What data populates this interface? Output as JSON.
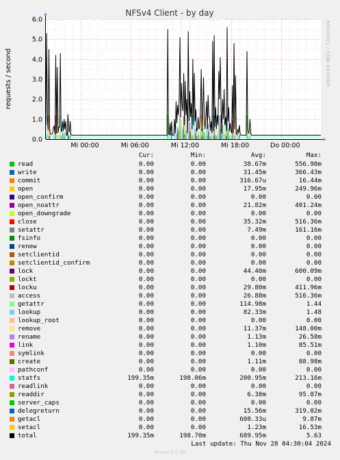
{
  "chart_data": {
    "type": "line",
    "title": "NFSv4 Client - by day",
    "ylabel": "requests / second",
    "ylim": [
      0,
      6
    ],
    "yticks": [
      "0.0",
      "1.0",
      "2.0",
      "3.0",
      "4.0",
      "5.0",
      "6.0"
    ],
    "xticks": [
      "Mi 00:00",
      "Mi 06:00",
      "Mi 12:00",
      "Mi 18:00",
      "Do 00:00"
    ],
    "grid": true,
    "series_total": {
      "name": "total",
      "color": "#000000",
      "values": [
        0.7,
        5.3,
        1.1,
        0.45,
        4.5,
        0.5,
        0.25,
        0.25,
        0.25,
        0.3,
        0.6,
        0.65,
        0.25,
        4.2,
        0.3,
        3.6,
        0.3,
        0.6,
        0.6,
        4.3,
        0.5,
        0.35,
        0.9,
        0.4,
        1.0,
        0.5,
        0.9,
        0.2,
        0.2,
        1.25,
        0.5,
        0.35,
        0.9,
        0.25,
        0.2,
        0.2,
        0.2,
        0.2,
        0.2,
        0.2,
        0.2,
        0.2,
        0.2,
        0.2,
        0.2,
        0.2,
        0.2,
        0.2,
        0.2,
        0.2,
        0.2,
        0.2,
        0.2,
        0.2,
        0.2,
        0.2,
        0.2,
        0.2,
        0.2,
        0.2,
        0.2,
        0.2,
        0.2,
        0.2,
        0.2,
        0.2,
        0.2,
        0.2,
        0.2,
        0.2,
        0.2,
        0.2,
        0.2,
        0.2,
        0.2,
        0.2,
        0.2,
        0.2,
        0.2,
        0.2,
        0.2,
        0.2,
        0.2,
        0.2,
        0.2,
        0.2,
        0.2,
        0.2,
        0.2,
        0.2,
        0.2,
        0.2,
        0.2,
        0.2,
        0.2,
        0.2,
        0.2,
        0.2,
        0.2,
        0.2,
        0.2,
        0.2,
        0.2,
        0.2,
        0.2,
        0.2,
        0.2,
        0.2,
        0.2,
        0.2,
        0.2,
        0.2,
        0.2,
        0.2,
        0.2,
        0.2,
        0.2,
        0.2,
        0.2,
        0.2,
        0.2,
        0.2,
        0.2,
        0.2,
        0.2,
        0.2,
        0.2,
        0.2,
        0.2,
        0.2,
        0.2,
        0.2,
        0.2,
        0.2,
        0.2,
        0.2,
        0.2,
        0.2,
        0.2,
        0.2,
        0.2,
        0.2,
        0.2,
        0.2,
        0.2,
        0.2,
        0.2,
        0.2,
        0.2,
        0.2,
        0.2,
        0.2,
        0.2,
        0.2,
        0.2,
        0.2,
        0.2,
        0.2,
        0.2,
        0.2,
        5.5,
        0.3,
        0.2,
        0.8,
        0.2,
        0.9,
        0.2,
        0.2,
        0.2,
        1.0,
        0.3,
        1.9,
        0.8,
        1.7,
        1.2,
        2.0,
        5.1,
        1.1,
        2.8,
        1.7,
        1.4,
        3.3,
        0.7,
        2.9,
        1.2,
        2.0,
        0.3,
        5.4,
        0.9,
        2.4,
        1.1,
        1.8,
        0.5,
        4.0,
        0.7,
        3.3,
        0.9,
        1.5,
        0.4,
        0.5,
        1.1,
        0.5,
        0.6,
        1.6,
        3.5,
        0.4,
        1.5,
        3.1,
        1.0,
        0.5,
        1.2,
        1.9,
        0.5,
        2.2,
        1.1,
        1.1,
        0.4,
        0.9,
        0.3,
        4.9,
        0.4,
        5.2,
        0.6,
        1.6,
        0.5,
        1.2,
        0.7,
        3.4,
        2.0,
        4.1,
        1.5,
        0.3,
        2.0,
        1.0,
        2.5,
        0.7,
        1.1,
        0.4,
        5.6,
        0.9,
        1.6,
        0.4,
        0.8,
        0.4,
        0.3,
        2.7,
        0.3,
        4.8,
        0.5,
        3.2,
        0.3,
        0.2,
        0.5,
        0.3,
        0.7,
        0.3,
        0.2,
        0.2,
        0.2,
        0.2,
        0.2,
        0.2,
        0.2,
        0.2,
        4.4,
        0.5,
        0.3,
        0.4,
        1.0,
        0.3,
        0.2,
        0.2,
        0.2,
        0.2,
        0.2,
        0.2,
        0.2,
        0.2,
        0.2,
        0.2,
        0.2,
        0.2,
        0.2,
        0.2,
        0.2,
        0.2,
        0.2,
        0.2,
        0.2,
        0.2,
        0.2,
        0.2,
        0.2,
        0.2,
        0.2,
        0.2,
        0.2,
        0.2,
        0.2,
        0.2,
        0.2,
        0.2,
        0.2,
        0.2,
        0.2,
        0.2,
        0.2,
        0.2,
        0.2,
        0.2,
        0.2,
        0.2,
        0.2,
        0.2,
        0.2,
        0.2,
        0.2,
        0.2,
        0.2,
        0.2,
        0.2,
        0.2,
        0.2,
        0.2,
        0.2,
        0.2,
        0.2,
        0.2,
        0.2,
        0.2,
        0.2,
        0.2,
        0.2,
        0.2,
        0.2,
        0.2,
        0.2,
        0.2,
        0.2,
        0.2,
        0.2,
        0.2,
        0.2,
        0.2,
        0.2,
        0.2,
        0.2,
        0.2,
        0.2,
        0.2,
        0.2,
        0.2,
        0.2,
        0.2,
        0.2,
        0.2,
        0.2,
        0.2,
        0.2,
        0.2,
        0.2,
        0.2
      ]
    }
  },
  "legend_headers": {
    "cur": "Cur:",
    "min": "Min:",
    "avg": "Avg:",
    "max": "Max:"
  },
  "legend": [
    {
      "name": "read",
      "color": "#00cc00",
      "cur": "0.00",
      "min": "0.00",
      "avg": "38.67m",
      "max": "556.98m"
    },
    {
      "name": "write",
      "color": "#0066b3",
      "cur": "0.00",
      "min": "0.00",
      "avg": "31.45m",
      "max": "366.43m"
    },
    {
      "name": "commit",
      "color": "#ff8000",
      "cur": "0.00",
      "min": "0.00",
      "avg": "316.67u",
      "max": "16.44m"
    },
    {
      "name": "open",
      "color": "#ffcc00",
      "cur": "0.00",
      "min": "0.00",
      "avg": "17.95m",
      "max": "249.96m"
    },
    {
      "name": "open_confirm",
      "color": "#330099",
      "cur": "0.00",
      "min": "0.00",
      "avg": "0.00",
      "max": "0.00"
    },
    {
      "name": "open_noattr",
      "color": "#990099",
      "cur": "0.00",
      "min": "0.00",
      "avg": "21.82m",
      "max": "401.24m"
    },
    {
      "name": "open_downgrade",
      "color": "#ccff00",
      "cur": "0.00",
      "min": "0.00",
      "avg": "0.00",
      "max": "0.00"
    },
    {
      "name": "close",
      "color": "#ff0000",
      "cur": "0.00",
      "min": "0.00",
      "avg": "35.32m",
      "max": "516.36m"
    },
    {
      "name": "setattr",
      "color": "#808080",
      "cur": "0.00",
      "min": "0.00",
      "avg": "7.49m",
      "max": "161.16m"
    },
    {
      "name": "fsinfo",
      "color": "#008f00",
      "cur": "0.00",
      "min": "0.00",
      "avg": "0.00",
      "max": "0.00"
    },
    {
      "name": "renew",
      "color": "#00487d",
      "cur": "0.00",
      "min": "0.00",
      "avg": "0.00",
      "max": "0.00"
    },
    {
      "name": "setclientid",
      "color": "#b35a00",
      "cur": "0.00",
      "min": "0.00",
      "avg": "0.00",
      "max": "0.00"
    },
    {
      "name": "setclientid_confirm",
      "color": "#b38f00",
      "cur": "0.00",
      "min": "0.00",
      "avg": "0.00",
      "max": "0.00"
    },
    {
      "name": "lock",
      "color": "#6b006b",
      "cur": "0.00",
      "min": "0.00",
      "avg": "44.40m",
      "max": "600.09m"
    },
    {
      "name": "lockt",
      "color": "#8fb300",
      "cur": "0.00",
      "min": "0.00",
      "avg": "0.00",
      "max": "0.00"
    },
    {
      "name": "locku",
      "color": "#b30000",
      "cur": "0.00",
      "min": "0.00",
      "avg": "29.80m",
      "max": "411.96m"
    },
    {
      "name": "access",
      "color": "#bebebe",
      "cur": "0.00",
      "min": "0.00",
      "avg": "26.88m",
      "max": "516.36m"
    },
    {
      "name": "getattr",
      "color": "#80ff80",
      "cur": "0.00",
      "min": "0.00",
      "avg": "114.98m",
      "max": "1.44"
    },
    {
      "name": "lookup",
      "color": "#80c9ff",
      "cur": "0.00",
      "min": "0.00",
      "avg": "82.33m",
      "max": "1.48"
    },
    {
      "name": "lookup_root",
      "color": "#ffc080",
      "cur": "0.00",
      "min": "0.00",
      "avg": "0.00",
      "max": "0.00"
    },
    {
      "name": "remove",
      "color": "#ffe680",
      "cur": "0.00",
      "min": "0.00",
      "avg": "11.37m",
      "max": "148.00m"
    },
    {
      "name": "rename",
      "color": "#aa80ff",
      "cur": "0.00",
      "min": "0.00",
      "avg": "1.13m",
      "max": "26.58m"
    },
    {
      "name": "link",
      "color": "#ee00cc",
      "cur": "0.00",
      "min": "0.00",
      "avg": "1.10m",
      "max": "85.51m"
    },
    {
      "name": "symlink",
      "color": "#ff8080",
      "cur": "0.00",
      "min": "0.00",
      "avg": "0.00",
      "max": "0.00"
    },
    {
      "name": "create",
      "color": "#666600",
      "cur": "0.00",
      "min": "0.00",
      "avg": "1.11m",
      "max": "88.98m"
    },
    {
      "name": "pathconf",
      "color": "#ffbfff",
      "cur": "0.00",
      "min": "0.00",
      "avg": "0.00",
      "max": "0.00"
    },
    {
      "name": "statfs",
      "color": "#00ffcc",
      "cur": "199.35m",
      "min": "198.06m",
      "avg": "200.95m",
      "max": "213.16m"
    },
    {
      "name": "readlink",
      "color": "#cc6699",
      "cur": "0.00",
      "min": "0.00",
      "avg": "0.00",
      "max": "0.00"
    },
    {
      "name": "readdir",
      "color": "#999900",
      "cur": "0.00",
      "min": "0.00",
      "avg": "6.38m",
      "max": "95.87m"
    },
    {
      "name": "server_caps",
      "color": "#00cc00",
      "cur": "0.00",
      "min": "0.00",
      "avg": "0.00",
      "max": "0.00"
    },
    {
      "name": "delegreturn",
      "color": "#0066b3",
      "cur": "0.00",
      "min": "0.00",
      "avg": "15.56m",
      "max": "319.02m"
    },
    {
      "name": "getacl",
      "color": "#ff8000",
      "cur": "0.00",
      "min": "0.00",
      "avg": "608.33u",
      "max": "9.87m"
    },
    {
      "name": "setacl",
      "color": "#ffcc00",
      "cur": "0.00",
      "min": "0.00",
      "avg": "1.23m",
      "max": "16.53m"
    },
    {
      "name": "total",
      "color": "#000000",
      "cur": "199.35m",
      "min": "198.70m",
      "avg": "689.95m",
      "max": "5.63"
    }
  ],
  "footer": {
    "last_update": "Last update: Thu Nov 28 04:30:04 2024",
    "munin": "Munin 2.0.56",
    "rrdtool": "RRDTOOL / TOBI OETIKER"
  }
}
